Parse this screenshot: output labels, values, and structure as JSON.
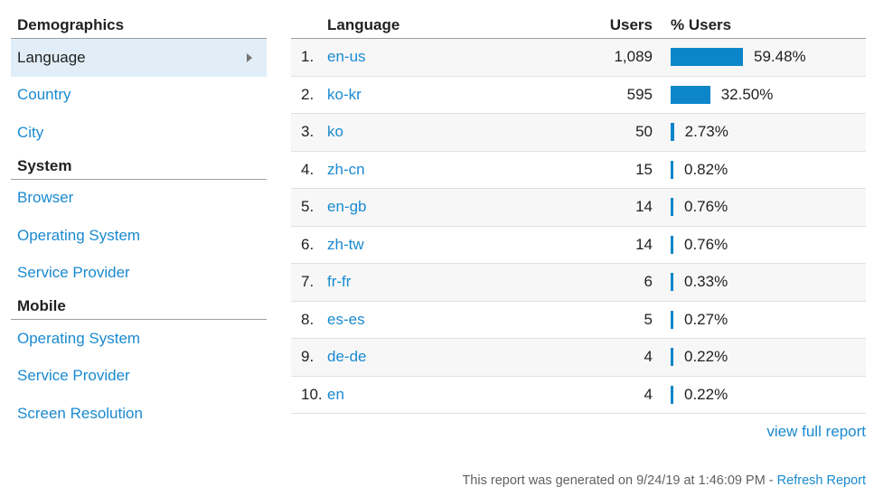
{
  "sidebar": {
    "demographics": {
      "header": "Demographics",
      "items": [
        "Language",
        "Country",
        "City"
      ]
    },
    "system": {
      "header": "System",
      "items": [
        "Browser",
        "Operating System",
        "Service Provider"
      ]
    },
    "mobile": {
      "header": "Mobile",
      "items": [
        "Operating System",
        "Service Provider",
        "Screen Resolution"
      ]
    }
  },
  "table": {
    "headers": {
      "language": "Language",
      "users": "Users",
      "pct_users": "% Users"
    },
    "rows": [
      {
        "num": "1.",
        "lang": "en-us",
        "users": "1,089",
        "pct": "59.48%",
        "pct_value": 59.48
      },
      {
        "num": "2.",
        "lang": "ko-kr",
        "users": "595",
        "pct": "32.50%",
        "pct_value": 32.5
      },
      {
        "num": "3.",
        "lang": "ko",
        "users": "50",
        "pct": "2.73%",
        "pct_value": 2.73
      },
      {
        "num": "4.",
        "lang": "zh-cn",
        "users": "15",
        "pct": "0.82%",
        "pct_value": 0.82
      },
      {
        "num": "5.",
        "lang": "en-gb",
        "users": "14",
        "pct": "0.76%",
        "pct_value": 0.76
      },
      {
        "num": "6.",
        "lang": "zh-tw",
        "users": "14",
        "pct": "0.76%",
        "pct_value": 0.76
      },
      {
        "num": "7.",
        "lang": "fr-fr",
        "users": "6",
        "pct": "0.33%",
        "pct_value": 0.33
      },
      {
        "num": "8.",
        "lang": "es-es",
        "users": "5",
        "pct": "0.27%",
        "pct_value": 0.27
      },
      {
        "num": "9.",
        "lang": "de-de",
        "users": "4",
        "pct": "0.22%",
        "pct_value": 0.22
      },
      {
        "num": "10.",
        "lang": "en",
        "users": "4",
        "pct": "0.22%",
        "pct_value": 0.22
      }
    ]
  },
  "links": {
    "full_report": "view full report"
  },
  "footer": {
    "generated_text": "This report was generated on 9/24/19 at 1:46:09 PM - ",
    "refresh": "Refresh Report"
  },
  "colors": {
    "accent": "#1a8ad0",
    "bar": "#0d86c9",
    "active_bg": "#e1eef7"
  }
}
